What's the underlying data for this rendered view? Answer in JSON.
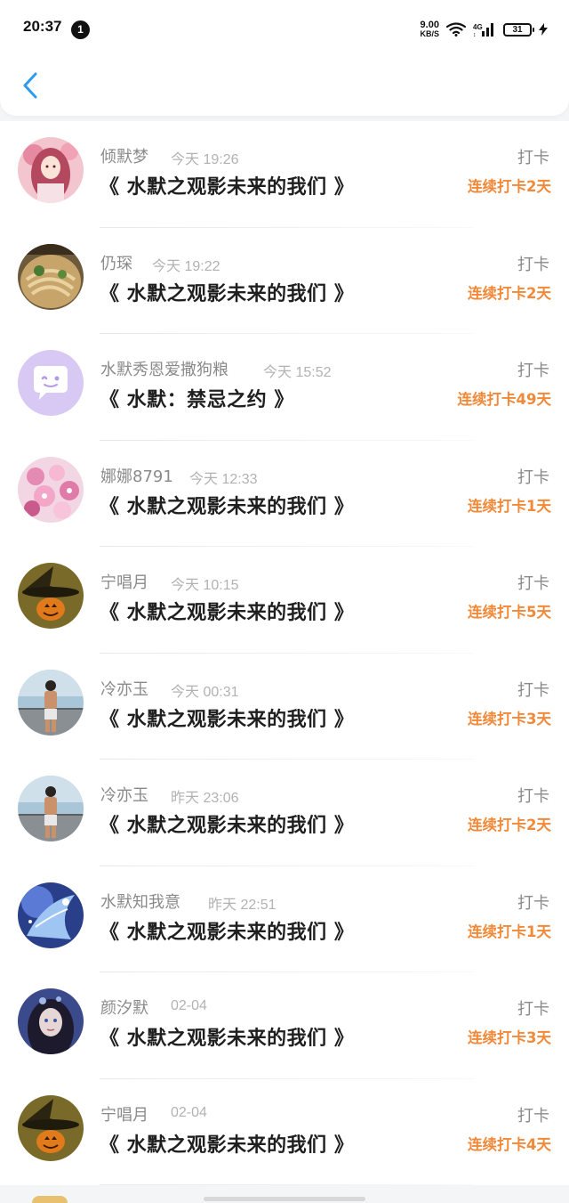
{
  "status_bar": {
    "time": "20:37",
    "notification_count": "1",
    "net_speed_value": "9.00",
    "net_speed_unit": "KB/S",
    "signal_label": "4G",
    "battery": "31"
  },
  "header": {
    "back_icon": "chevron-left-icon",
    "accent_color": "#2d9bf0"
  },
  "action_color": "#f08a3a",
  "items": [
    {
      "name": "倾默梦",
      "time": "今天 19:26",
      "title": "《 水默之观影未来的我们 》",
      "action": "打卡",
      "streak": "连续打卡2天",
      "avatar": "pink-anime-girl"
    },
    {
      "name": "仍琛",
      "time": "今天 19:22",
      "title": "《 水默之观影未来的我们 》",
      "action": "打卡",
      "streak": "连续打卡2天",
      "avatar": "noodle-bowl"
    },
    {
      "name": "水默秀恩爱撒狗粮",
      "time": "今天 15:52",
      "title": "《 水默：禁忌之约 》",
      "action": "打卡",
      "streak": "连续打卡49天",
      "avatar": "default-chat-bubble"
    },
    {
      "name": "娜娜8791",
      "time": "今天 12:33",
      "title": "《 水默之观影未来的我们 》",
      "action": "打卡",
      "streak": "连续打卡1天",
      "avatar": "pink-flowers"
    },
    {
      "name": "宁唱月",
      "time": "今天 10:15",
      "title": "《 水默之观影未来的我们 》",
      "action": "打卡",
      "streak": "连续打卡5天",
      "avatar": "witch-hat-pumpkin"
    },
    {
      "name": "冷亦玉",
      "time": "今天 00:31",
      "title": "《 水默之观影未来的我们 》",
      "action": "打卡",
      "streak": "连续打卡3天",
      "avatar": "man-on-pier"
    },
    {
      "name": "冷亦玉",
      "time": "昨天 23:06",
      "title": "《 水默之观影未来的我们 》",
      "action": "打卡",
      "streak": "连续打卡2天",
      "avatar": "man-on-pier"
    },
    {
      "name": "水默知我意",
      "time": "昨天 22:51",
      "title": "《 水默之观影未来的我们 》",
      "action": "打卡",
      "streak": "连续打卡1天",
      "avatar": "blue-fantasy-art"
    },
    {
      "name": "颜汐默",
      "time": "02-04",
      "title": "《 水默之观影未来的我们 》",
      "action": "打卡",
      "streak": "连续打卡3天",
      "avatar": "cg-girl-portrait"
    },
    {
      "name": "宁唱月",
      "time": "02-04",
      "title": "《 水默之观影未来的我们 》",
      "action": "打卡",
      "streak": "连续打卡4天",
      "avatar": "witch-hat-pumpkin"
    }
  ]
}
